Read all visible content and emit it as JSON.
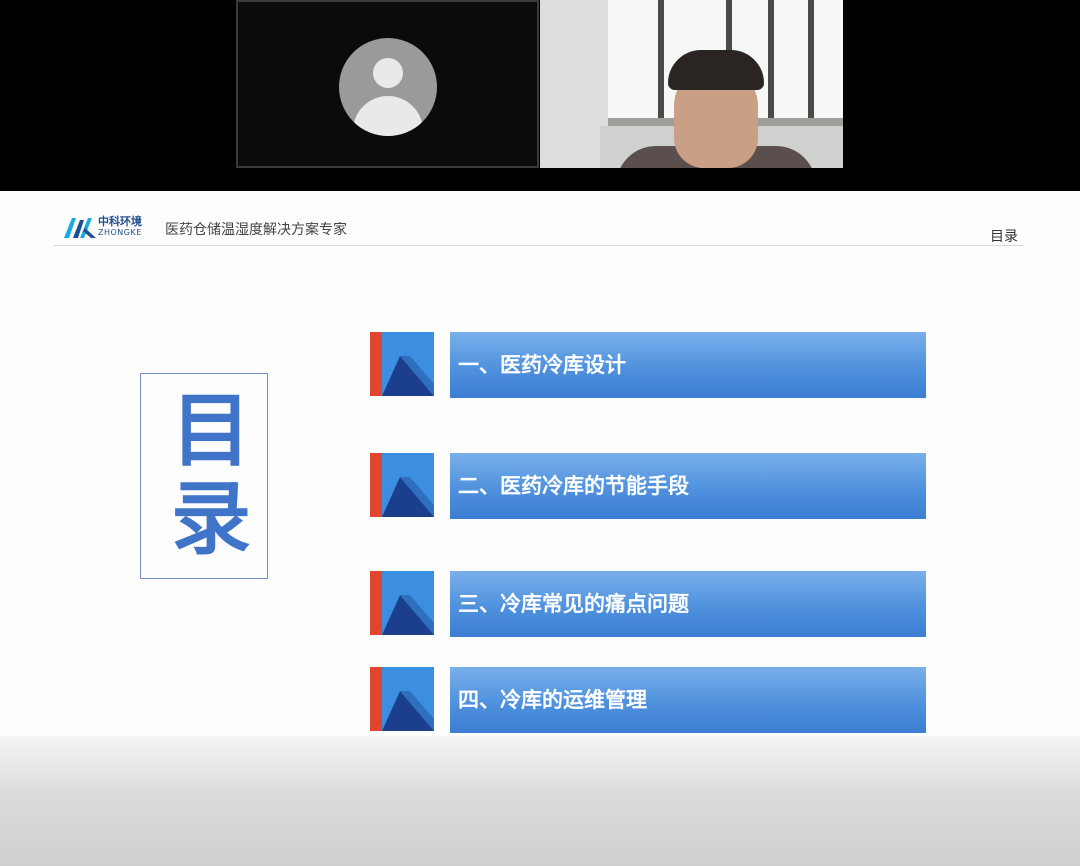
{
  "slide": {
    "logo": {
      "cn": "中科环境",
      "en": "ZHONGKE"
    },
    "tagline": "医药仓储温湿度解决方案专家",
    "header_label": "目录",
    "toc_title": "目录",
    "items": [
      {
        "label": "一、医药冷库设计"
      },
      {
        "label": "二、医药冷库的节能手段"
      },
      {
        "label": "三、冷库常见的痛点问题"
      },
      {
        "label": "四、冷库的运维管理"
      }
    ]
  },
  "colors": {
    "accent_blue": "#4f91dd",
    "icon_red": "#e0452f",
    "icon_navy": "#1b3f8c"
  }
}
